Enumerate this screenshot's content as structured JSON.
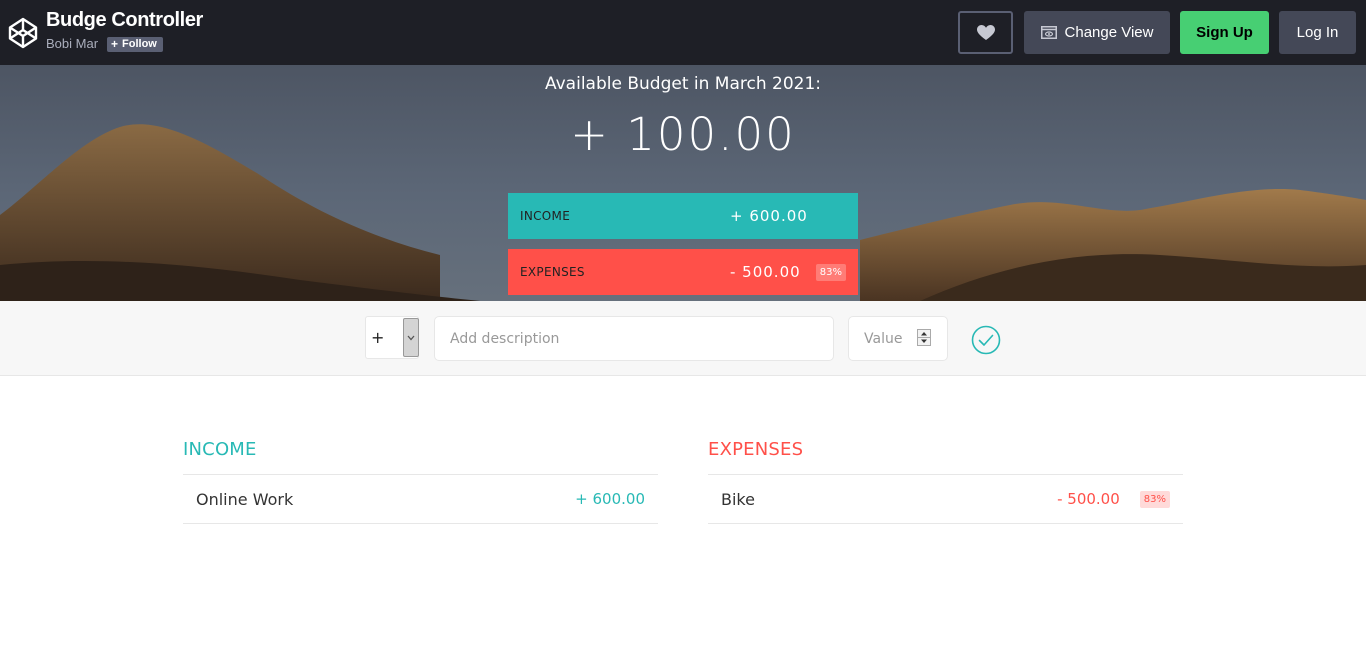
{
  "header": {
    "title": "Budge Controller",
    "author": "Bobi Mar",
    "follow_label": "Follow",
    "follow_icon": "plus-icon",
    "heart_icon": "heart-icon",
    "change_view_label": "Change View",
    "change_view_icon": "eye-window-icon",
    "signup_label": "Sign Up",
    "login_label": "Log In"
  },
  "budget": {
    "title": "Available Budget in March 2021:",
    "value": "+ 100.00",
    "income_label": "INCOME",
    "income_value": "+ 600.00",
    "expenses_label": "EXPENSES",
    "expenses_value": "- 500.00",
    "expenses_percentage": "83%"
  },
  "add": {
    "type_value": "+",
    "description_placeholder": "Add description",
    "value_placeholder": "Value",
    "submit_icon": "check-circle-icon"
  },
  "income": {
    "title": "INCOME",
    "items": [
      {
        "description": "Online Work",
        "value": "+ 600.00"
      }
    ]
  },
  "expenses": {
    "title": "EXPENSES",
    "items": [
      {
        "description": "Bike",
        "value": "- 500.00",
        "percentage": "83%"
      }
    ]
  },
  "colors": {
    "income": "#28b9b5",
    "expenses": "#ff5049",
    "topbar": "#1e1f26",
    "signup": "#47cf73"
  }
}
